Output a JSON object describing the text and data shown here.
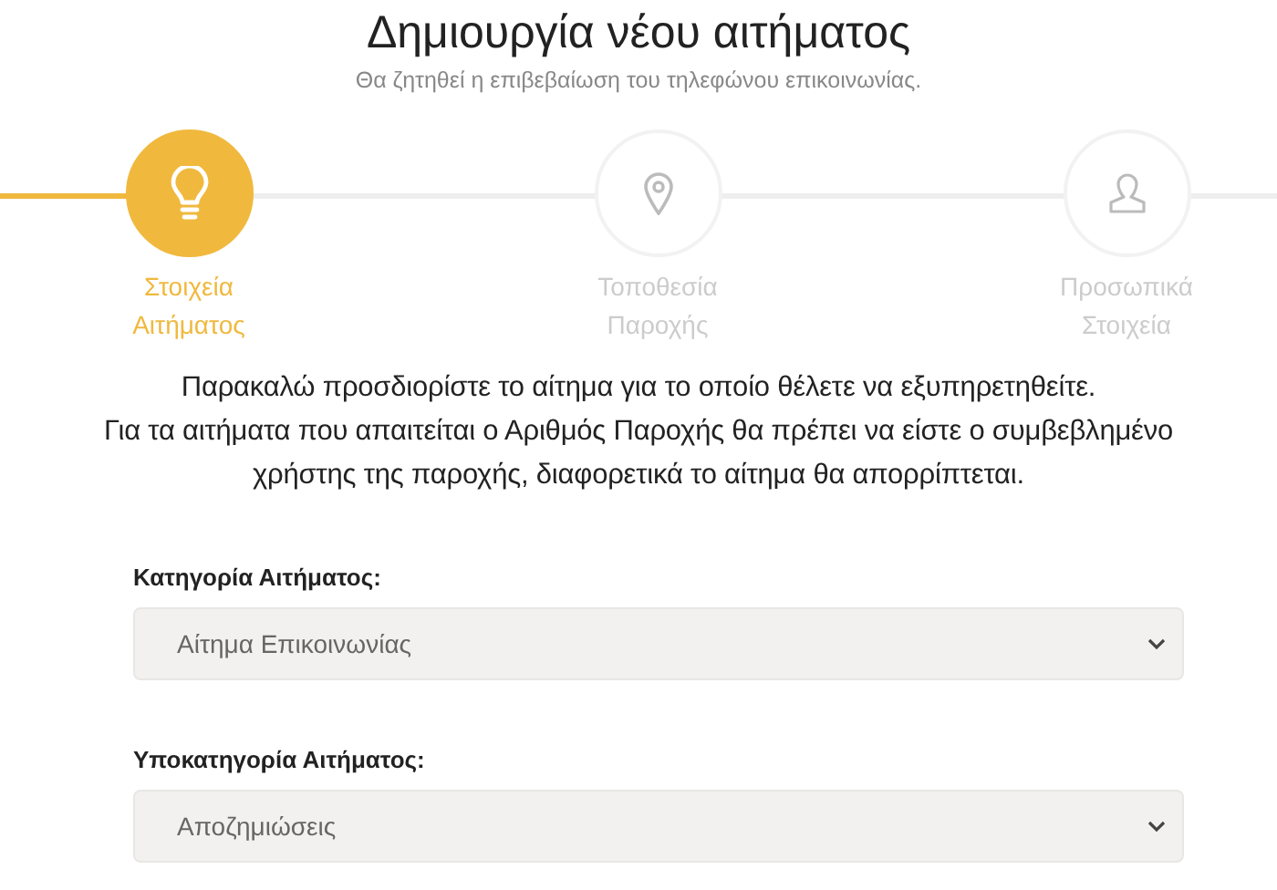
{
  "header": {
    "title": "Δημιουργία νέου αιτήματος",
    "subtitle": "Θα ζητηθεί η επιβεβαίωση του τηλεφώνου επικοινωνίας."
  },
  "steps": [
    {
      "kind": "bulb",
      "label": [
        "Στοιχεία",
        "Αιτήματος"
      ],
      "selected": true
    },
    {
      "kind": "pin",
      "label": [
        "Τοποθεσία",
        "Παροχής"
      ],
      "selected": false
    },
    {
      "kind": "person",
      "label": [
        "Προσωπικά",
        "Στοιχεία"
      ],
      "selected": false
    }
  ],
  "intro": [
    "Παρακαλώ προσδιορίστε το αίτημα για το οποίο θέλετε να εξυπηρετηθείτε.",
    "Για τα αιτήματα που απαιτείται ο Αριθμός Παροχής θα πρέπει να είστε ο συμβεβλημένο",
    "χρήστης της παροχής, διαφορετικά το αίτημα θα απορρίπτεται."
  ],
  "fields": [
    {
      "label": "Κατηγορία Αιτήματος:",
      "value": "Αίτημα Επικοινωνίας"
    },
    {
      "label": "Υποκατηγορία Αιτήματος:",
      "value": "Αποζημιώσεις"
    }
  ]
}
